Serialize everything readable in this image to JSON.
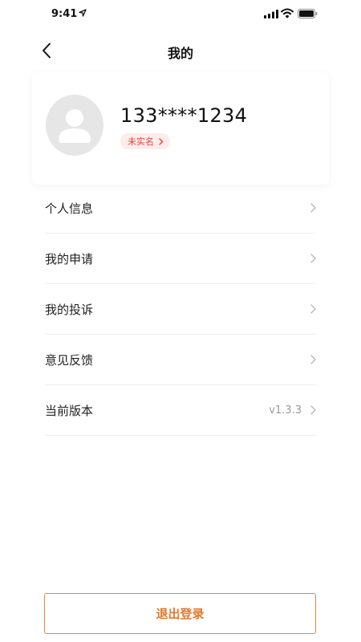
{
  "status_bar": {
    "time": "9:41"
  },
  "nav": {
    "title": "我的"
  },
  "profile": {
    "phone": "133****1234",
    "verify_status": "未实名"
  },
  "menu": {
    "items": [
      {
        "label": "个人信息",
        "value": ""
      },
      {
        "label": "我的申请",
        "value": ""
      },
      {
        "label": "我的投诉",
        "value": ""
      },
      {
        "label": "意见反馈",
        "value": ""
      },
      {
        "label": "当前版本",
        "value": "v1.3.3"
      }
    ]
  },
  "logout": {
    "label": "退出登录"
  },
  "colors": {
    "accent": "#e8873c",
    "badge_bg": "#fdeceb",
    "badge_text": "#e0473a",
    "avatar_bg": "#e6e6e6",
    "divider": "#eeeeee"
  }
}
